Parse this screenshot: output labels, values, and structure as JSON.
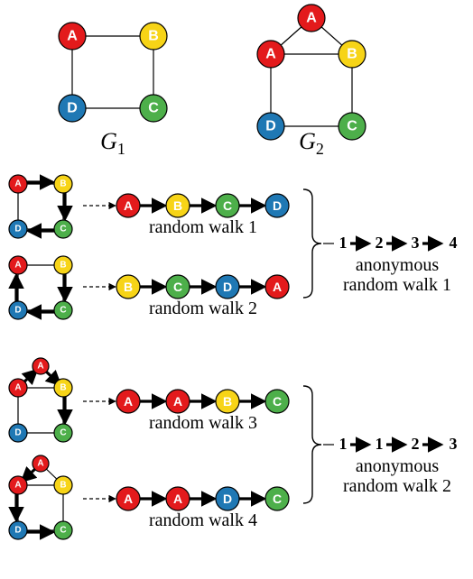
{
  "colors": {
    "red": "#e31a1c",
    "yellow": "#f7d417",
    "green": "#4daf4a",
    "blue": "#1f78b4"
  },
  "top": {
    "G1": {
      "label": "G",
      "sub": "1",
      "nodes": [
        {
          "id": "A",
          "color": "red"
        },
        {
          "id": "B",
          "color": "yellow"
        },
        {
          "id": "C",
          "color": "green"
        },
        {
          "id": "D",
          "color": "blue"
        }
      ],
      "edges": [
        [
          "A",
          "B"
        ],
        [
          "B",
          "C"
        ],
        [
          "C",
          "D"
        ],
        [
          "D",
          "A"
        ]
      ]
    },
    "G2": {
      "label": "G",
      "sub": "2",
      "nodes": [
        {
          "id": "A_top",
          "label": "A",
          "color": "red"
        },
        {
          "id": "A",
          "color": "red"
        },
        {
          "id": "B",
          "color": "yellow"
        },
        {
          "id": "C",
          "color": "green"
        },
        {
          "id": "D",
          "color": "blue"
        }
      ],
      "edges": [
        [
          "A_top",
          "A"
        ],
        [
          "A_top",
          "B"
        ],
        [
          "A",
          "B"
        ],
        [
          "B",
          "C"
        ],
        [
          "C",
          "D"
        ],
        [
          "D",
          "A"
        ]
      ]
    }
  },
  "walks": {
    "rw1": {
      "caption": "random walk 1",
      "seq": [
        {
          "label": "A",
          "color": "red"
        },
        {
          "label": "B",
          "color": "yellow"
        },
        {
          "label": "C",
          "color": "green"
        },
        {
          "label": "D",
          "color": "blue"
        }
      ]
    },
    "rw2": {
      "caption": "random walk 2",
      "seq": [
        {
          "label": "B",
          "color": "yellow"
        },
        {
          "label": "C",
          "color": "green"
        },
        {
          "label": "D",
          "color": "blue"
        },
        {
          "label": "A",
          "color": "red"
        }
      ]
    },
    "rw3": {
      "caption": "random walk 3",
      "seq": [
        {
          "label": "A",
          "color": "red"
        },
        {
          "label": "A",
          "color": "red"
        },
        {
          "label": "B",
          "color": "yellow"
        },
        {
          "label": "C",
          "color": "green"
        }
      ]
    },
    "rw4": {
      "caption": "random walk 4",
      "seq": [
        {
          "label": "A",
          "color": "red"
        },
        {
          "label": "A",
          "color": "red"
        },
        {
          "label": "D",
          "color": "blue"
        },
        {
          "label": "C",
          "color": "green"
        }
      ]
    },
    "arw1": {
      "caption_l1": "anonymous",
      "caption_l2": "random walk 1",
      "seq": [
        "1",
        "2",
        "3",
        "4"
      ]
    },
    "arw2": {
      "caption_l1": "anonymous",
      "caption_l2": "random walk 2",
      "seq": [
        "1",
        "1",
        "2",
        "3"
      ]
    }
  },
  "chart_data": {
    "type": "diagram",
    "graphs": {
      "G1": {
        "nodes": [
          "A",
          "B",
          "C",
          "D"
        ],
        "edges": [
          [
            "A",
            "B"
          ],
          [
            "B",
            "C"
          ],
          [
            "C",
            "D"
          ],
          [
            "D",
            "A"
          ]
        ]
      },
      "G2": {
        "nodes": [
          "A_top",
          "A",
          "B",
          "C",
          "D"
        ],
        "labels": {
          "A_top": "A"
        },
        "edges": [
          [
            "A_top",
            "A"
          ],
          [
            "A_top",
            "B"
          ],
          [
            "A",
            "B"
          ],
          [
            "B",
            "C"
          ],
          [
            "C",
            "D"
          ],
          [
            "D",
            "A"
          ]
        ]
      }
    },
    "random_walks": {
      "1": [
        "A",
        "B",
        "C",
        "D"
      ],
      "2": [
        "B",
        "C",
        "D",
        "A"
      ],
      "3": [
        "A",
        "A",
        "B",
        "C"
      ],
      "4": [
        "A",
        "A",
        "D",
        "C"
      ]
    },
    "anonymous_random_walks": {
      "1": [
        1,
        2,
        3,
        4
      ],
      "2": [
        1,
        1,
        2,
        3
      ]
    },
    "mapping": {
      "walks_1_2_to": "anonymous_random_walk_1",
      "walks_3_4_to": "anonymous_random_walk_2"
    }
  }
}
